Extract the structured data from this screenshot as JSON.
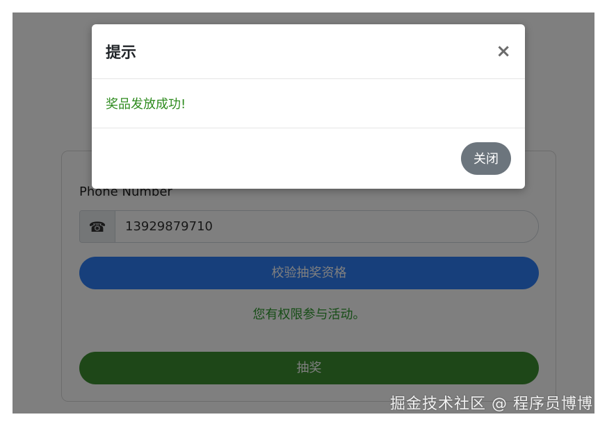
{
  "form": {
    "phone_label": "Phone Number",
    "phone_icon": "phone-icon",
    "phone_value": "13929879710",
    "verify_button_label": "校验抽奖资格",
    "status_message": "您有权限参与活动。",
    "draw_button_label": "抽奖"
  },
  "modal": {
    "title": "提示",
    "close_symbol": "×",
    "message": "奖品发放成功!",
    "close_button_label": "关闭"
  },
  "watermark": "掘金技术社区 @ 程序员博博",
  "colors": {
    "verify_button": "#2f7ef6",
    "draw_button": "#3c8f31",
    "success_text": "#2e8b1e",
    "close_button": "#6c757d"
  }
}
